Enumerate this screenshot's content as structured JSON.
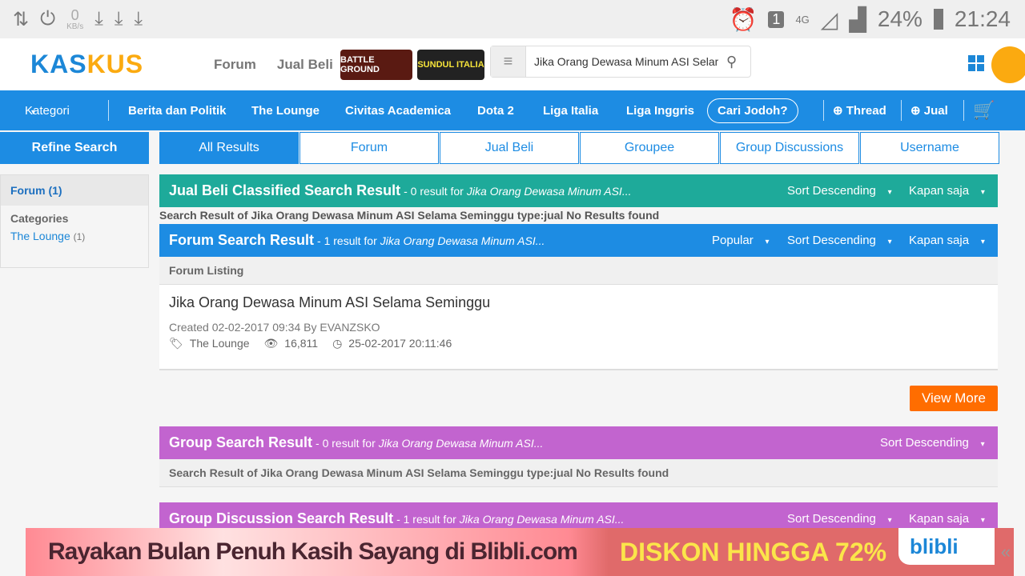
{
  "status": {
    "kbs_value": "0",
    "kbs_unit": "KB/s",
    "sim": "1",
    "net": "4G",
    "battery": "24%",
    "time": "21:24"
  },
  "header": {
    "logo_a": "KAS",
    "logo_b": "KUS",
    "nav": [
      "Forum",
      "Jual Beli"
    ],
    "badge1": "BATTLE GROUND",
    "badge2": "SUNDUL ITALIA",
    "search_value": "Jika Orang Dewasa Minum ASI Selama Seminggu"
  },
  "catnav": {
    "kategori": "Kategori",
    "items": [
      "Berita dan Politik",
      "The Lounge",
      "Civitas Academica",
      "Dota 2",
      "Liga Italia",
      "Liga Inggris"
    ],
    "jodoh": "Cari Jodoh?",
    "thread": "Thread",
    "jual": "Jual"
  },
  "sidebar": {
    "refine": "Refine Search",
    "forum": "Forum (1)",
    "categories": "Categories",
    "cat_item": "The Lounge",
    "cat_count": "(1)"
  },
  "tabs": [
    "All Results",
    "Forum",
    "Jual Beli",
    "Groupee",
    "Group Discussions",
    "Username"
  ],
  "jualbeli": {
    "title": "Jual Beli Classified Search Result",
    "sub": "- 0 result for",
    "query": "Jika Orang Dewasa Minum ASI...",
    "sort": "Sort Descending",
    "time": "Kapan saja",
    "note": "Search Result of Jika Orang Dewasa Minum ASI Selama Seminggu type:jual No Results found"
  },
  "forum": {
    "title": "Forum Search Result",
    "sub": "- 1 result for",
    "query": "Jika Orang Dewasa Minum ASI...",
    "popular": "Popular",
    "sort": "Sort Descending",
    "time": "Kapan saja",
    "listing": "Forum Listing",
    "result": {
      "title": "Jika Orang Dewasa Minum ASI Selama Seminggu",
      "created": "Created 02-02-2017 09:34 By EVANZSKO",
      "category": "The Lounge",
      "views": "16,811",
      "last": "25-02-2017 20:11:46"
    },
    "view_more": "View More"
  },
  "group": {
    "title": "Group Search Result",
    "sub": "- 0 result for",
    "query": "Jika Orang Dewasa Minum ASI...",
    "sort": "Sort Descending",
    "note": "Search Result of Jika Orang Dewasa Minum ASI Selama Seminggu type:jual No Results found"
  },
  "groupdisc": {
    "title": "Group Discussion Search Result",
    "sub": "- 1 result for",
    "query": "Jika Orang Dewasa Minum ASI...",
    "sort": "Sort Descending",
    "time": "Kapan saja"
  },
  "ad": {
    "text": "Rayakan Bulan Penuh Kasih Sayang di Blibli.com",
    "promo": "DISKON HINGGA 72%",
    "brand": "blibli"
  },
  "colors": {
    "blue": "#1d8ce3",
    "teal": "#1eaa9a",
    "purple": "#c264cf",
    "orange": "#ff6d00"
  }
}
